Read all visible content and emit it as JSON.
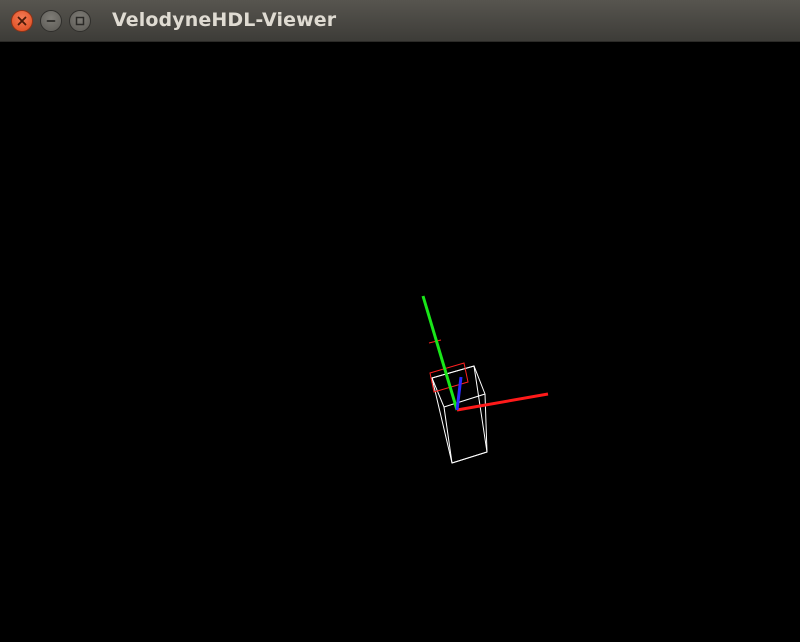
{
  "window": {
    "title": "VelodyneHDL-Viewer",
    "buttons": {
      "close": "close-icon",
      "minimize": "minimize-icon",
      "maximize": "maximize-icon"
    }
  },
  "viewport": {
    "background": "#000000",
    "axes_colors": {
      "x": "#ff1a1a",
      "y": "#19e619",
      "z": "#2a2aff"
    },
    "box_color": "#ffffff",
    "top_face_color": "#ff2020"
  }
}
